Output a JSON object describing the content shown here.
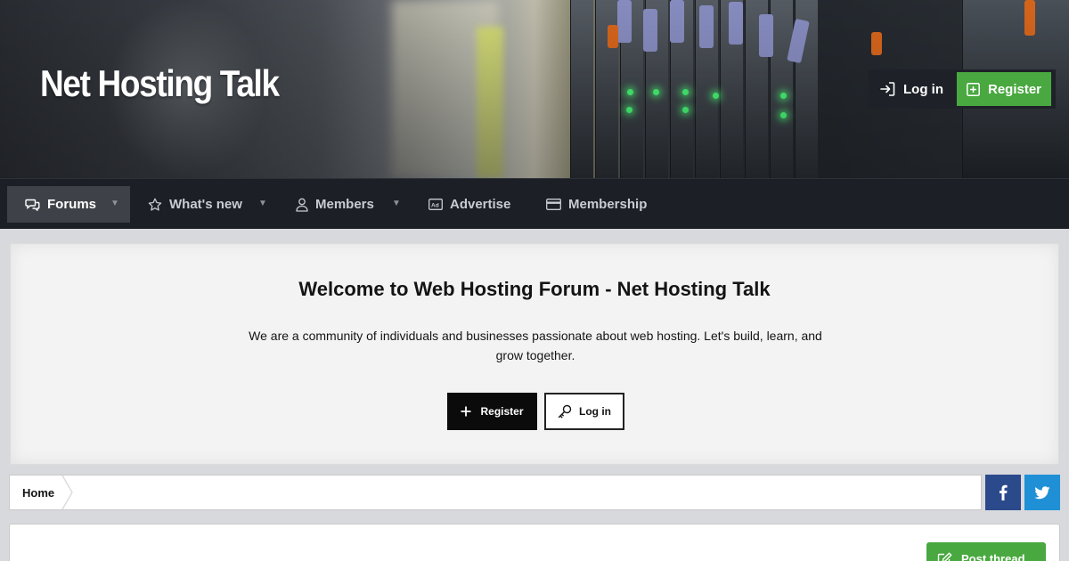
{
  "header": {
    "site_title": "Net Hosting Talk",
    "login_label": "Log in",
    "register_label": "Register"
  },
  "nav": {
    "items": [
      {
        "label": "Forums",
        "icon": "chat-bubbles-icon",
        "active": true,
        "dropdown": true
      },
      {
        "label": "What's new",
        "icon": "star-icon",
        "active": false,
        "dropdown": true
      },
      {
        "label": "Members",
        "icon": "user-icon",
        "active": false,
        "dropdown": true
      },
      {
        "label": "Advertise",
        "icon": "ad-icon",
        "active": false,
        "dropdown": false
      },
      {
        "label": "Membership",
        "icon": "credit-card-icon",
        "active": false,
        "dropdown": false
      }
    ]
  },
  "welcome": {
    "title": "Welcome to Web Hosting Forum - Net Hosting Talk",
    "text": "We are a community of individuals and businesses passionate about web hosting. Let's build, learn, and grow together.",
    "register_label": "Register",
    "login_label": "Log in"
  },
  "breadcrumb": {
    "home_label": "Home"
  },
  "share": {
    "facebook_icon": "facebook-icon",
    "twitter_icon": "twitter-icon"
  },
  "actions": {
    "post_thread_label": "Post thread"
  },
  "colors": {
    "nav_bg": "#1c2026",
    "register_green": "#49a83f",
    "facebook_blue": "#2b4a8b",
    "twitter_blue": "#1f90d6"
  }
}
